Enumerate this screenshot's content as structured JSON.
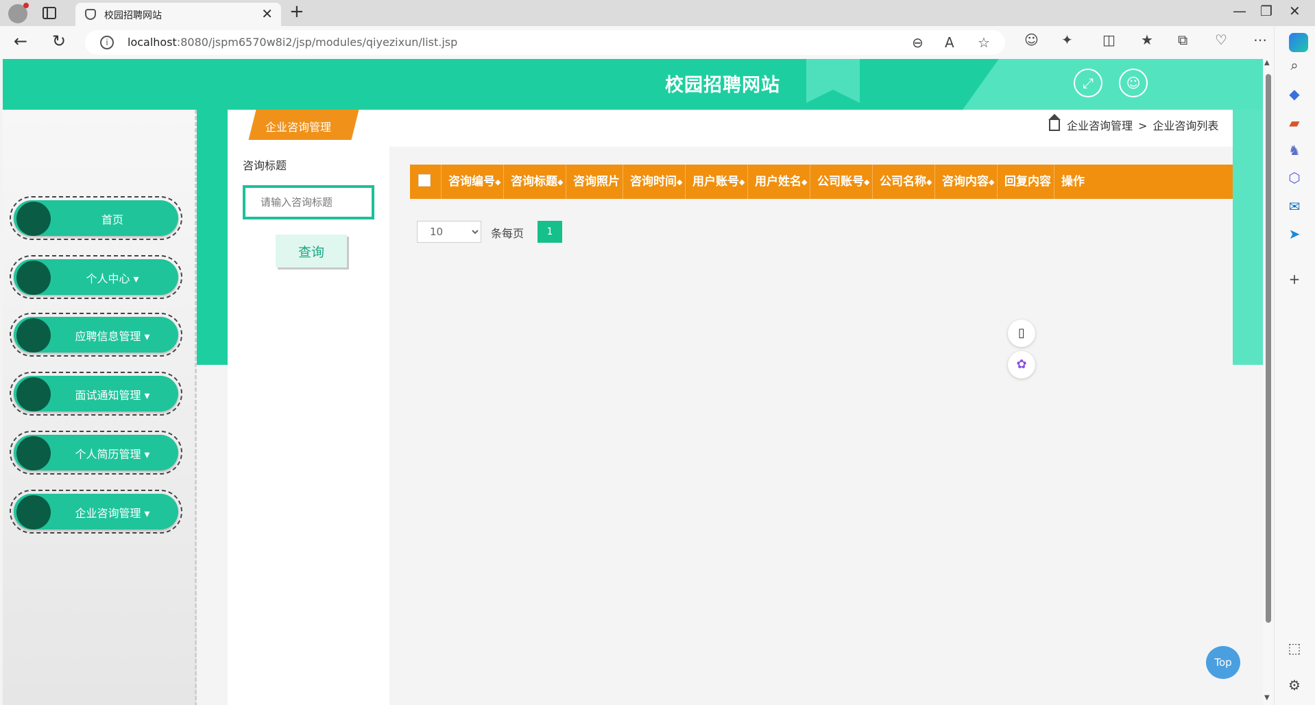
{
  "browser": {
    "tab_title": "校园招聘网站",
    "url_host": "localhost",
    "url_path": ":8080/jspm6570w8i2/jsp/modules/qiyezixun/list.jsp",
    "icons": [
      "profile-icon",
      "tabs-icon",
      "back-icon",
      "reload-icon",
      "info-icon",
      "zoom-out-icon",
      "read-aloud-icon",
      "favorite-icon",
      "extension-icon",
      "split-icon",
      "favorites-icon",
      "collections-icon",
      "health-icon",
      "more-icon"
    ]
  },
  "header": {
    "title": "校园招聘网站",
    "accent_color": "#1dcfa0"
  },
  "sidebar": {
    "items": [
      {
        "label": "首页"
      },
      {
        "label": "个人中心 ▾"
      },
      {
        "label": "应聘信息管理 ▾"
      },
      {
        "label": "面试通知管理 ▾"
      },
      {
        "label": "个人简历管理 ▾"
      },
      {
        "label": "企业咨询管理 ▾"
      }
    ]
  },
  "section": {
    "tab_label": "企业咨询管理",
    "breadcrumb": [
      "企业咨询管理",
      "企业咨询列表"
    ],
    "breadcrumb_sep": ">"
  },
  "search": {
    "label": "咨询标题",
    "placeholder": "请输入咨询标题",
    "button": "查询"
  },
  "table": {
    "header_color": "#f0900e",
    "columns": [
      {
        "label": "咨询编号",
        "sortable": true
      },
      {
        "label": "咨询标题",
        "sortable": true
      },
      {
        "label": "咨询照片",
        "sortable": false
      },
      {
        "label": "咨询时间",
        "sortable": true
      },
      {
        "label": "用户账号",
        "sortable": true
      },
      {
        "label": "用户姓名",
        "sortable": true
      },
      {
        "label": "公司账号",
        "sortable": true
      },
      {
        "label": "公司名称",
        "sortable": true
      },
      {
        "label": "咨询内容",
        "sortable": true
      },
      {
        "label": "回复内容",
        "sortable": false
      },
      {
        "label": "操作",
        "sortable": false
      }
    ]
  },
  "pagination": {
    "page_size": "10",
    "per_page_label": "条每页",
    "current_page": "1"
  },
  "floating": {
    "top_label": "Top"
  }
}
